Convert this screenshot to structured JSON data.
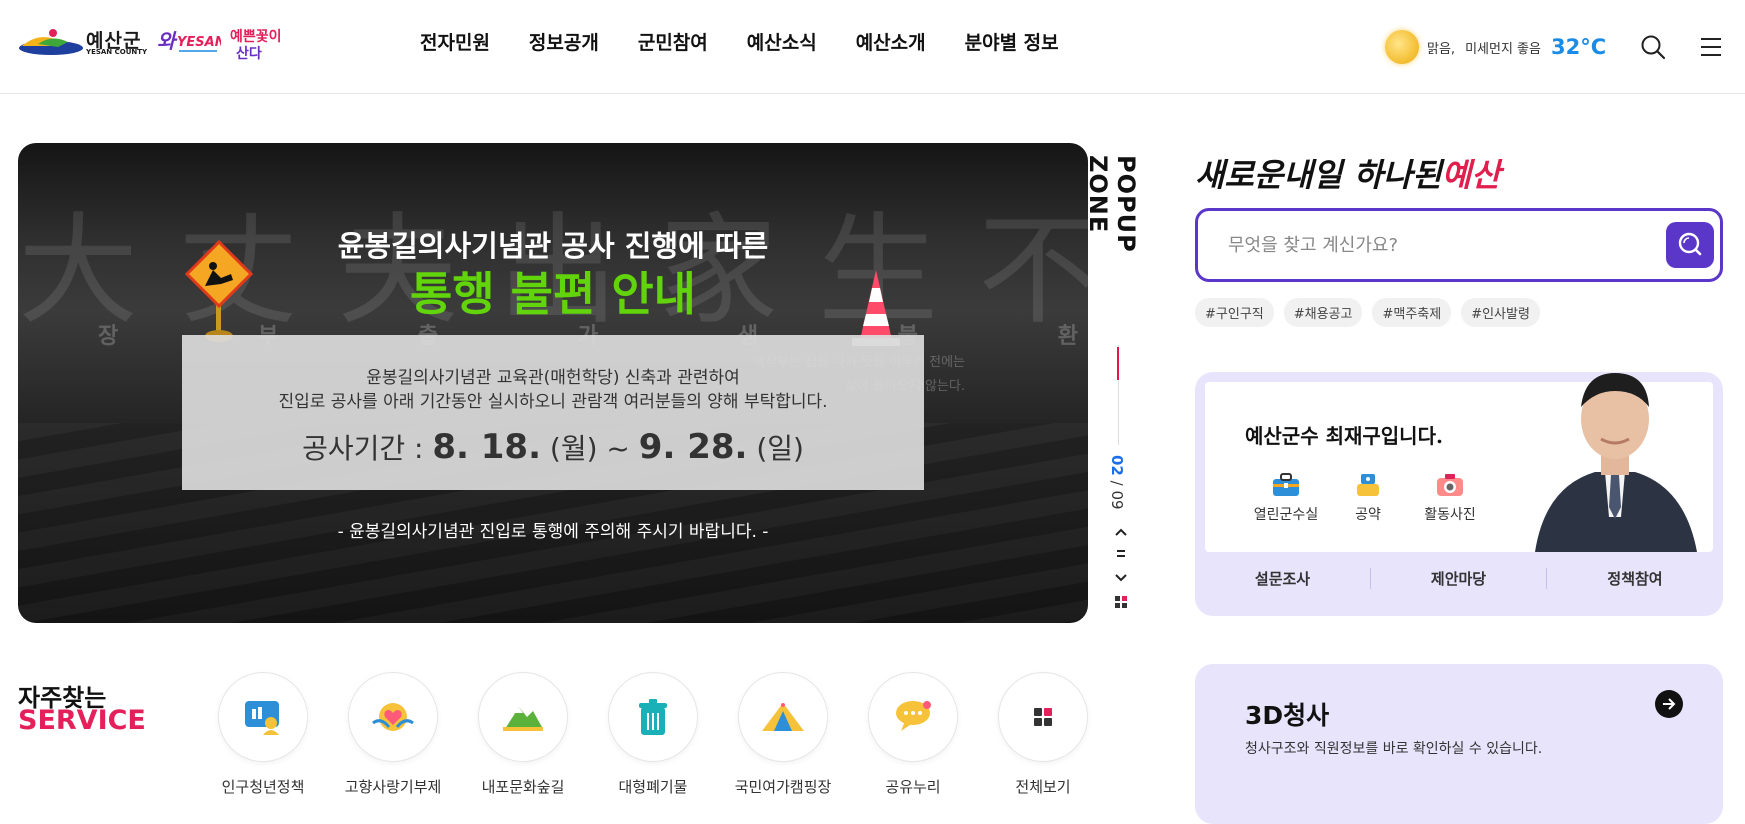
{
  "header": {
    "logo_text": "예산군",
    "logo_sub": "YESAN COUNTY",
    "badge1_text": "와YESAN!",
    "badge2_text": "예쁜꽃이 산다",
    "nav": [
      "전자민원",
      "정보공개",
      "군민참여",
      "예산소식",
      "예산소개",
      "분야별 정보"
    ],
    "weather": {
      "condition": "맑음,",
      "dust": "미세먼지 좋음",
      "temp": "32°C"
    },
    "icons": {
      "search": "search-icon",
      "menu": "hamburger-menu-icon",
      "weather": "sun-icon"
    }
  },
  "banner": {
    "title1": "윤봉길의사기념관 공사 진행에 따른",
    "title2": "통행 불편 안내",
    "bg_text": [
      "장",
      "부",
      "출",
      "가",
      "생",
      "불",
      "환"
    ],
    "bg_poem": [
      "백장부는 집을 나가 뜻을 이루기 전에는",
      "살아 돌아오지 않는다."
    ],
    "info_line1": "윤봉길의사기념관 교육관(매헌학당) 신축과 관련하여",
    "info_line2": "진입로 공사를 아래 기간동안 실시하오니 관람객 여러분들의 양해 부탁합니다.",
    "period_label": "공사기간 :",
    "period_start": "8. 18.",
    "period_start_day": "(월)",
    "period_tilde": "~",
    "period_end": "9. 28.",
    "period_end_day": "(일)",
    "note": "- 윤봉길의사기념관 진입로 통행에 주의해 주시기 바랍니다. -"
  },
  "popup": {
    "label": "POPUP ZONE",
    "current": "02",
    "separator": " / ",
    "total": "09",
    "controls": {
      "prev": "chevron-up-icon",
      "pause": "pause-icon",
      "next": "chevron-down-icon",
      "all": "grid-icon"
    }
  },
  "search": {
    "slogan_main": "새로운내일 하나된",
    "slogan_accent": "예산",
    "placeholder": "무엇을 찾고 계신가요?",
    "tags": [
      "#구인구직",
      "#채용공고",
      "#맥주축제",
      "#인사발령"
    ]
  },
  "mayor": {
    "title": "예산군수 최재구입니다.",
    "links": [
      {
        "label": "열린군수실",
        "icon": "briefcase-icon"
      },
      {
        "label": "공약",
        "icon": "pledge-icon"
      },
      {
        "label": "활동사진",
        "icon": "camera-icon"
      }
    ],
    "bottom": [
      "설문조사",
      "제안마당",
      "정책참여"
    ]
  },
  "card3d": {
    "title": "3D청사",
    "desc": "청사구조와 직원정보를 바로 확인하실 수 있습니다.",
    "arrow_icon": "arrow-right-icon"
  },
  "services": {
    "title1": "자주찾는",
    "title2": "SERVICE",
    "items": [
      {
        "label": "인구청년정책",
        "icon": "population-policy-icon"
      },
      {
        "label": "고향사랑기부제",
        "icon": "hometown-donation-icon"
      },
      {
        "label": "내포문화숲길",
        "icon": "forest-trail-icon"
      },
      {
        "label": "대형폐기물",
        "icon": "trash-bin-icon"
      },
      {
        "label": "국민여가캠핑장",
        "icon": "camping-tent-icon"
      },
      {
        "label": "공유누리",
        "icon": "shared-chat-icon"
      },
      {
        "label": "전체보기",
        "icon": "grid-all-icon"
      }
    ]
  },
  "colors": {
    "brand_purple": "#5a36c9",
    "accent_red": "#e3205a",
    "banner_green": "#61d40b",
    "temp_blue": "#1a8be6",
    "card_lavender": "#e7e4fb"
  }
}
